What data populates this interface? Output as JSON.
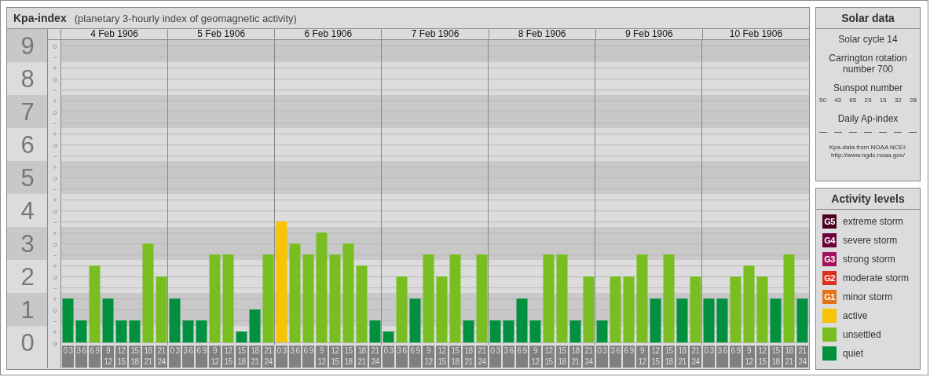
{
  "kpa_panel": {
    "title": "Kpa-index",
    "subtitle": "(planetary 3-hourly index of geomagnetic activity)",
    "scale_marks": [
      "o",
      "−",
      "+",
      "o",
      "−",
      "+",
      "o",
      "−",
      "+",
      "o",
      "−",
      "+",
      "o",
      "−",
      "+",
      "o",
      "−",
      "+",
      "o",
      "−",
      "+",
      "o",
      "−",
      "+",
      "o",
      "−",
      "+",
      "o"
    ],
    "days": [
      "4 Feb 1906",
      "5 Feb 1906",
      "6 Feb 1906",
      "7 Feb 1906",
      "8 Feb 1906",
      "9 Feb 1906",
      "10 Feb 1906"
    ],
    "chart_data": {
      "type": "bar",
      "ylim": [
        0,
        9.17
      ],
      "grid": true,
      "yticks": [
        0,
        1,
        2,
        3,
        4,
        5,
        6,
        7,
        8,
        9
      ],
      "categories": [
        "0 3",
        "3 6",
        "6 9",
        "9 12",
        "12 15",
        "15 18",
        "18 21",
        "21 24",
        "0 3",
        "3 6",
        "6 9",
        "9 12",
        "12 15",
        "15 18",
        "18 21",
        "21 24",
        "0 3",
        "3 6",
        "6 9",
        "9 12",
        "12 15",
        "15 18",
        "18 21",
        "21 24",
        "0 3",
        "3 6",
        "6 9",
        "9 12",
        "12 15",
        "15 18",
        "18 21",
        "21 24",
        "0 3",
        "3 6",
        "6 9",
        "9 12",
        "12 15",
        "15 18",
        "18 21",
        "21 24",
        "0 3",
        "3 6",
        "6 9",
        "9 12",
        "12 15",
        "15 18",
        "18 21",
        "21 24",
        "0 3",
        "3 6",
        "6 9",
        "9 12",
        "12 15",
        "15 18",
        "18 21",
        "21 24"
      ],
      "series": [
        {
          "color": "#00903e",
          "values": [
            1.33,
            0.67,
            null,
            1.33,
            0.67,
            0.67,
            null,
            null,
            1.33,
            0.67,
            0.67,
            null,
            null,
            0.33,
            1,
            null,
            null,
            null,
            null,
            null,
            null,
            null,
            null,
            0.67,
            0.33,
            null,
            1.33,
            null,
            null,
            null,
            0.67,
            null,
            0.67,
            0.67,
            1.33,
            0.67,
            null,
            null,
            0.67,
            null,
            0.67,
            null,
            null,
            null,
            1.33,
            null,
            1.33,
            null,
            1.33,
            1.33,
            null,
            null,
            null,
            1.33,
            null,
            1.33
          ]
        },
        {
          "color": "#78be20",
          "values": [
            null,
            null,
            2.33,
            null,
            null,
            null,
            3,
            2,
            null,
            null,
            null,
            2.67,
            2.67,
            null,
            null,
            2.67,
            null,
            3,
            2.67,
            3.33,
            2.67,
            3,
            2.33,
            null,
            null,
            2,
            null,
            2.67,
            2,
            2.67,
            null,
            2.67,
            null,
            null,
            null,
            null,
            2.67,
            2.67,
            null,
            2,
            null,
            2,
            2,
            2.67,
            null,
            2.67,
            null,
            2,
            null,
            null,
            2,
            2.33,
            2,
            null,
            2.67,
            null
          ]
        },
        {
          "color": "#f8c300",
          "values": [
            null,
            null,
            null,
            null,
            null,
            null,
            null,
            null,
            null,
            null,
            null,
            null,
            null,
            null,
            null,
            null,
            3.67,
            null,
            null,
            null,
            null,
            null,
            null,
            null,
            null,
            null,
            null,
            null,
            null,
            null,
            null,
            null,
            null,
            null,
            null,
            null,
            null,
            null,
            null,
            null,
            null,
            null,
            null,
            null,
            null,
            null,
            null,
            null,
            null,
            null,
            null,
            null,
            null,
            null,
            null,
            null
          ]
        }
      ]
    }
  },
  "solar_data": {
    "title": "Solar data",
    "solar_cycle": "Solar cycle 14",
    "carrington": "Carrington rotation number 700",
    "sunspot_heading": "Sunspot number",
    "sunspot_numbers": [
      "50",
      "43",
      "65",
      "23",
      "15",
      "32",
      "28"
    ],
    "ap_heading": "Daily Ap-index",
    "ap_values": [
      "—",
      "—",
      "—",
      "—",
      "—",
      "—",
      "—"
    ],
    "source": "Kpa-data from NOAA NCEI:",
    "source_url": "http://www.ngdc.noaa.gov/"
  },
  "activity_legend": {
    "title": "Activity levels",
    "items": [
      {
        "badge": "G5",
        "label": "extreme storm",
        "color": "#4a0022"
      },
      {
        "badge": "G4",
        "label": "severe storm",
        "color": "#6a003e"
      },
      {
        "badge": "G3",
        "label": "strong storm",
        "color": "#a3115e"
      },
      {
        "badge": "G2",
        "label": "moderate storm",
        "color": "#d9301f"
      },
      {
        "badge": "G1",
        "label": "minor storm",
        "color": "#e2731b"
      },
      {
        "label": "active",
        "color": "#f8c300"
      },
      {
        "label": "unsettled",
        "color": "#78be20"
      },
      {
        "label": "quiet",
        "color": "#00903e"
      }
    ]
  }
}
